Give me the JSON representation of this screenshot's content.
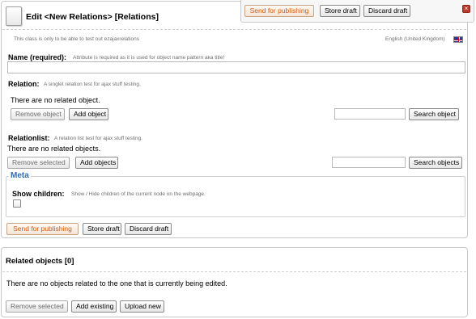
{
  "header": {
    "title": "Edit <New Relations> [Relations]",
    "class_description": "This class is only to be able to test out ezajaxrelations",
    "language": "English (United Kingdom)"
  },
  "toolbar_top": {
    "send": "Send for publishing",
    "store": "Store draft",
    "discard": "Discard draft"
  },
  "fields": {
    "name": {
      "label": "Name (required):",
      "hint": "Attribute is required as it is used for object name pattern aka title!",
      "value": ""
    },
    "relation": {
      "label": "Relation:",
      "hint": "A singlet relation test for ajax stuff testing.",
      "empty": "There are no related object.",
      "remove": "Remove object",
      "add": "Add object",
      "search": "Search object",
      "search_value": ""
    },
    "relationlist": {
      "label": "Relationlist:",
      "hint": "A relation list test for ajax stuff testing.",
      "empty": "There are no related objects.",
      "remove": "Remove selected",
      "add": "Add objects",
      "search": "Search objects",
      "search_value": ""
    },
    "meta": {
      "legend": "Meta",
      "show_children_label": "Show children:",
      "show_children_hint": "Show / Hide children of the current node on the webpage.",
      "show_children_checked": false
    }
  },
  "toolbar_bottom": {
    "send": "Send for publishing",
    "store": "Store draft",
    "discard": "Discard draft"
  },
  "related": {
    "title": "Related objects [0]",
    "empty": "There are no objects related to the one that is currently being edited.",
    "remove": "Remove selected",
    "add": "Add existing",
    "upload": "Upload new"
  },
  "colors": {
    "accent": "#d75a0c",
    "legend": "#2e6db4",
    "close": "#c0392b"
  }
}
